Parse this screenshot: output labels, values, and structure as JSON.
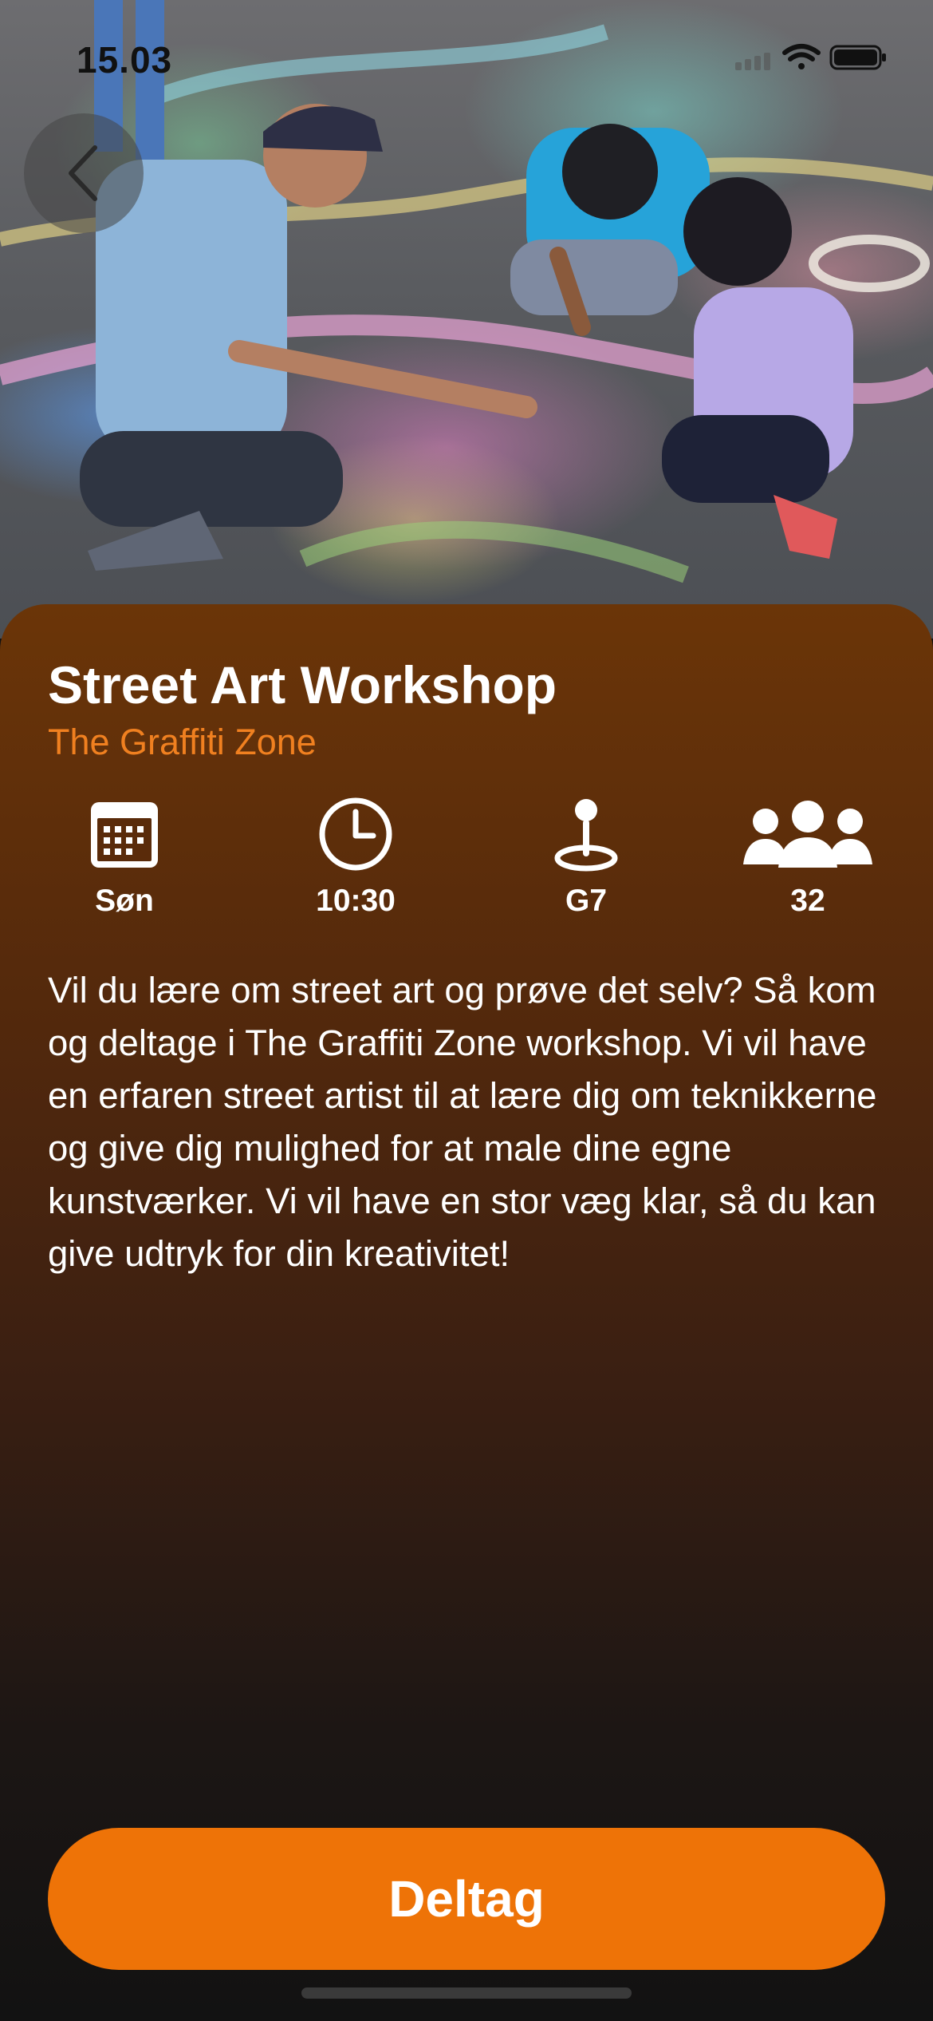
{
  "status_bar": {
    "time": "15.03",
    "icons": [
      "cellular-signal-icon",
      "wifi-icon",
      "battery-icon"
    ]
  },
  "navigation": {
    "back_icon": "chevron-left-icon"
  },
  "event": {
    "title": "Street Art Workshop",
    "location_name": "The Graffiti Zone",
    "info": [
      {
        "icon": "calendar-icon",
        "value": "Søn"
      },
      {
        "icon": "clock-icon",
        "value": "10:30"
      },
      {
        "icon": "map-pin-icon",
        "value": "G7"
      },
      {
        "icon": "people-icon",
        "value": "32"
      }
    ],
    "description": "Vil du lære om street art og prøve det selv? Så kom og deltage i The Graffiti Zone workshop. Vi vil have en erfaren street artist til at lære dig om teknikkerne og give dig mulighed for at male dine egne kunstværker. Vi vil have en stor væg klar, så du kan give udtryk for din kreativitet!"
  },
  "actions": {
    "join_label": "Deltag"
  },
  "colors": {
    "accent": "#ee7307",
    "subtitle": "#f08020",
    "sheet_top": "#6b3508",
    "sheet_bottom": "#121212"
  }
}
